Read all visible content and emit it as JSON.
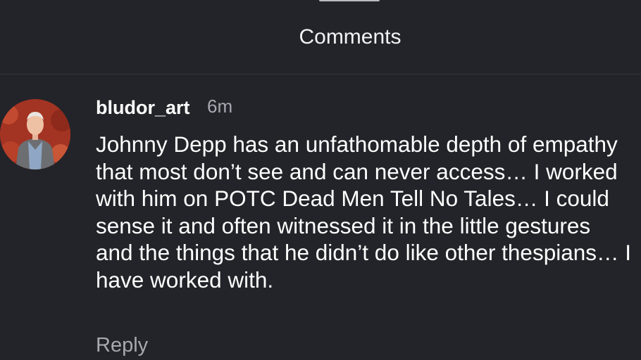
{
  "header": {
    "title": "Comments"
  },
  "comment": {
    "username": "bludor_art",
    "timestamp": "6m",
    "text": "Johnny Depp has an unfathomable depth of empathy that most don’t see and can never access… I worked with him on POTC Dead Men Tell No Tales… I could sense it and often witnessed it in the little gestures and the things that he didn’t do like other thespians… I have worked with.",
    "reply_label": "Reply"
  },
  "colors": {
    "background": "#232429",
    "divider": "#34363c",
    "primary_text": "#ffffff",
    "secondary_text": "#a6a9b0",
    "avatar_background": "#a33322"
  }
}
